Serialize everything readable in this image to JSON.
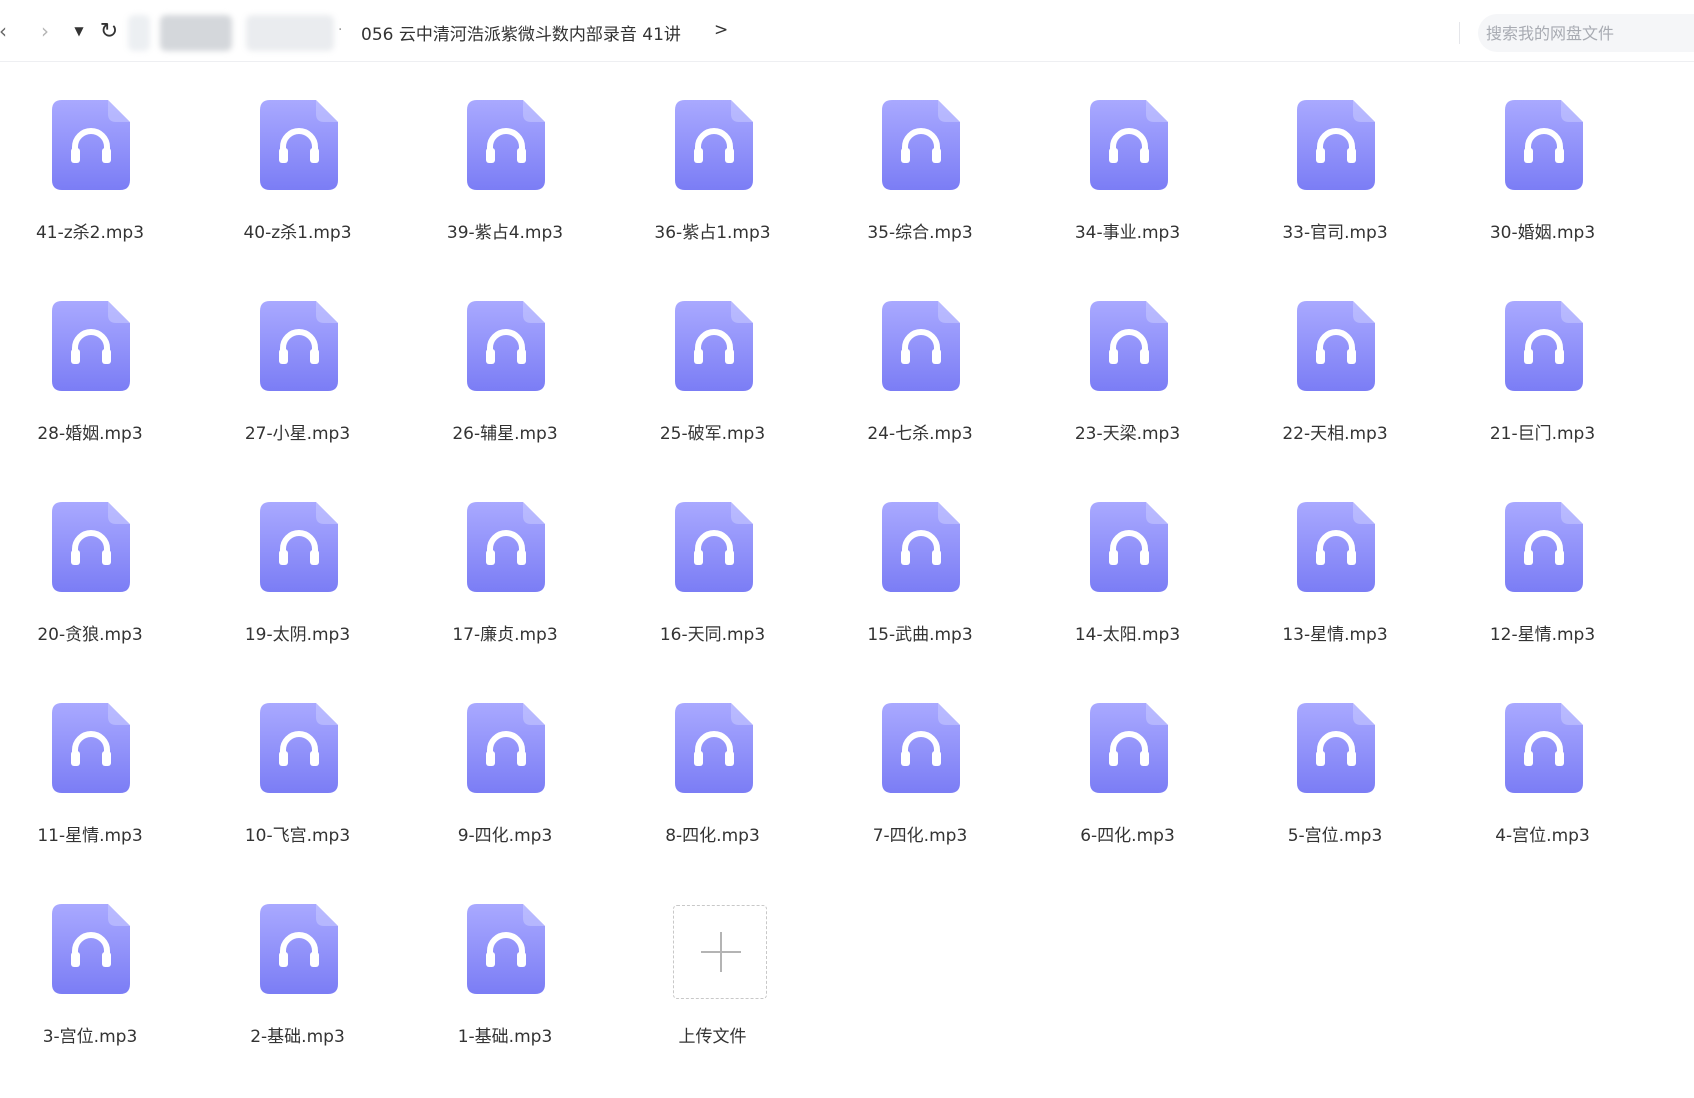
{
  "nav": {
    "back_icon": "chevron-left-icon",
    "forward_icon": "chevron-right-icon",
    "dropdown_icon": "caret-down-icon",
    "refresh_icon": "refresh-icon"
  },
  "breadcrumb": {
    "separator": "·",
    "current": "056 云中清河浩派紫微斗数内部录音 41讲",
    "chevron": ">"
  },
  "search": {
    "placeholder": "搜索我的网盘文件"
  },
  "colors": {
    "icon_top": "#a9a9ff",
    "icon_bottom": "#7b7df5",
    "fold": "#c9cbff"
  },
  "files": [
    {
      "name": "41-z杀2.mp3",
      "icon": "audio-file-icon"
    },
    {
      "name": "40-z杀1.mp3",
      "icon": "audio-file-icon"
    },
    {
      "name": "39-紫占4.mp3",
      "icon": "audio-file-icon"
    },
    {
      "name": "36-紫占1.mp3",
      "icon": "audio-file-icon"
    },
    {
      "name": "35-综合.mp3",
      "icon": "audio-file-icon"
    },
    {
      "name": "34-事业.mp3",
      "icon": "audio-file-icon"
    },
    {
      "name": "33-官司.mp3",
      "icon": "audio-file-icon"
    },
    {
      "name": "30-婚姻.mp3",
      "icon": "audio-file-icon"
    },
    {
      "name": "28-婚姻.mp3",
      "icon": "audio-file-icon"
    },
    {
      "name": "27-小星.mp3",
      "icon": "audio-file-icon"
    },
    {
      "name": "26-辅星.mp3",
      "icon": "audio-file-icon"
    },
    {
      "name": "25-破军.mp3",
      "icon": "audio-file-icon"
    },
    {
      "name": "24-七杀.mp3",
      "icon": "audio-file-icon"
    },
    {
      "name": "23-天梁.mp3",
      "icon": "audio-file-icon"
    },
    {
      "name": "22-天相.mp3",
      "icon": "audio-file-icon"
    },
    {
      "name": "21-巨门.mp3",
      "icon": "audio-file-icon"
    },
    {
      "name": "20-贪狼.mp3",
      "icon": "audio-file-icon"
    },
    {
      "name": "19-太阴.mp3",
      "icon": "audio-file-icon"
    },
    {
      "name": "17-廉贞.mp3",
      "icon": "audio-file-icon"
    },
    {
      "name": "16-天同.mp3",
      "icon": "audio-file-icon"
    },
    {
      "name": "15-武曲.mp3",
      "icon": "audio-file-icon"
    },
    {
      "name": "14-太阳.mp3",
      "icon": "audio-file-icon"
    },
    {
      "name": "13-星情.mp3",
      "icon": "audio-file-icon"
    },
    {
      "name": "12-星情.mp3",
      "icon": "audio-file-icon"
    },
    {
      "name": "11-星情.mp3",
      "icon": "audio-file-icon"
    },
    {
      "name": "10-飞宫.mp3",
      "icon": "audio-file-icon"
    },
    {
      "name": "9-四化.mp3",
      "icon": "audio-file-icon"
    },
    {
      "name": "8-四化.mp3",
      "icon": "audio-file-icon"
    },
    {
      "name": "7-四化.mp3",
      "icon": "audio-file-icon"
    },
    {
      "name": "6-四化.mp3",
      "icon": "audio-file-icon"
    },
    {
      "name": "5-宫位.mp3",
      "icon": "audio-file-icon"
    },
    {
      "name": "4-宫位.mp3",
      "icon": "audio-file-icon"
    },
    {
      "name": "3-宫位.mp3",
      "icon": "audio-file-icon"
    },
    {
      "name": "2-基础.mp3",
      "icon": "audio-file-icon"
    },
    {
      "name": "1-基础.mp3",
      "icon": "audio-file-icon"
    }
  ],
  "upload": {
    "label": "上传文件",
    "icon": "plus-icon"
  }
}
